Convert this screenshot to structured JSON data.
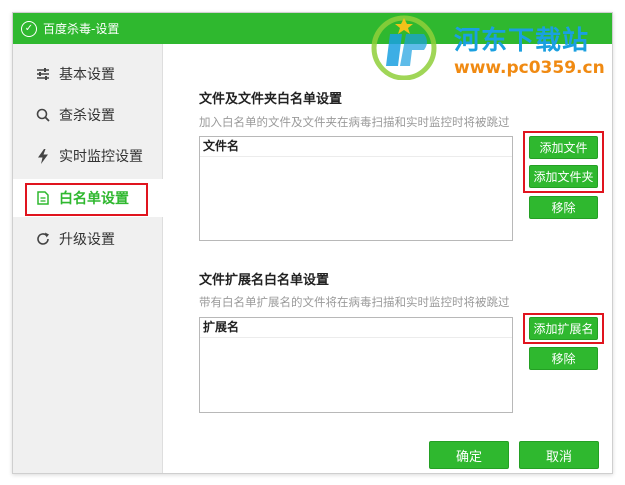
{
  "window": {
    "title": "百度杀毒-设置"
  },
  "watermark": {
    "name": "河东下载站",
    "url": "www.pc0359.cn"
  },
  "sidebar": {
    "items": [
      {
        "label": "基本设置",
        "icon": "sliders-icon"
      },
      {
        "label": "查杀设置",
        "icon": "search-icon"
      },
      {
        "label": "实时监控设置",
        "icon": "lightning-icon"
      },
      {
        "label": "白名单设置",
        "icon": "document-icon",
        "active": true
      },
      {
        "label": "升级设置",
        "icon": "refresh-icon"
      }
    ]
  },
  "file_whitelist": {
    "title": "文件及文件夹白名单设置",
    "description": "加入白名单的文件及文件夹在病毒扫描和实时监控时将被跳过",
    "column_header": "文件名",
    "add_file_label": "添加文件",
    "add_folder_label": "添加文件夹",
    "remove_label": "移除"
  },
  "ext_whitelist": {
    "title": "文件扩展名白名单设置",
    "description": "带有白名单扩展名的文件将在病毒扫描和实时监控时将被跳过",
    "column_header": "扩展名",
    "add_ext_label": "添加扩展名",
    "remove_label": "移除"
  },
  "footer": {
    "ok_label": "确定",
    "cancel_label": "取消"
  },
  "colors": {
    "accent": "#2fb82f",
    "highlight": "#e0141e"
  }
}
